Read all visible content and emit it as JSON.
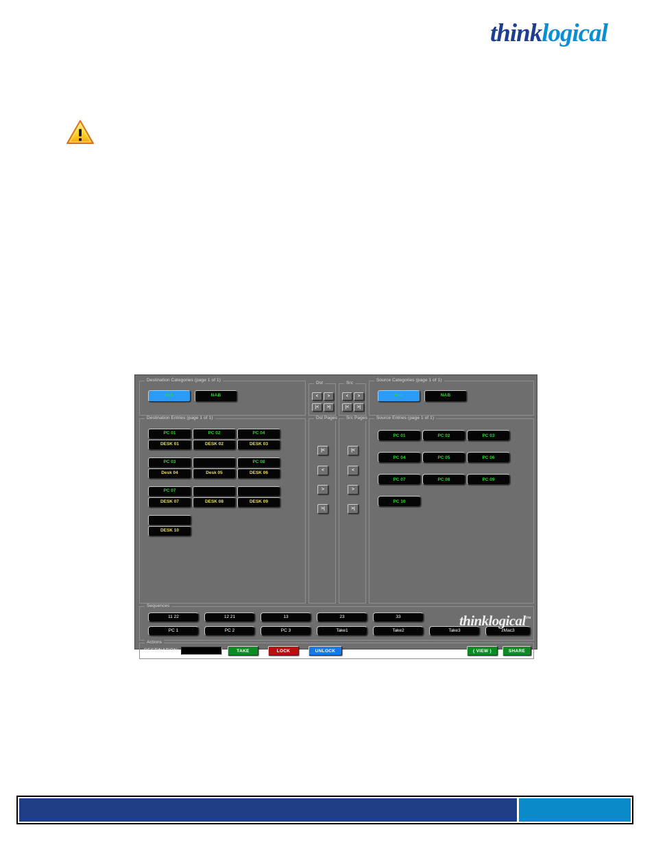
{
  "brand": {
    "part1": "think",
    "part2": "logical"
  },
  "footer": {
    "dark_color": "#1f3d85",
    "light_color": "#0a8ac8"
  },
  "app": {
    "dest_categories": {
      "title": "Destination Categories (page 1 of 1)",
      "buttons": [
        {
          "label": "ALL",
          "selected": true
        },
        {
          "label": "NAB",
          "selected": false
        }
      ]
    },
    "source_categories": {
      "title": "Source Categories (page 1 of 1)",
      "buttons": [
        {
          "label": "ALL",
          "selected": true
        },
        {
          "label": "NAB",
          "selected": false
        }
      ]
    },
    "dest_entries": {
      "title": "Destination Entries (page 1 of 1)",
      "items": [
        {
          "source": "PC 01",
          "dest": "DESK 01"
        },
        {
          "source": "PC 02",
          "dest": "DESK 02"
        },
        {
          "source": "PC 04",
          "dest": "DESK 03"
        },
        {
          "source": "PC 03",
          "dest": "Desk 04"
        },
        {
          "source": "",
          "dest": "Desk 05"
        },
        {
          "source": "PC 08",
          "dest": "DESK 06"
        },
        {
          "source": "PC 07",
          "dest": "DESK 07"
        },
        {
          "source": "",
          "dest": "DESK 08"
        },
        {
          "source": "",
          "dest": "DESK 09"
        },
        {
          "source": "",
          "dest": "DESK 10"
        }
      ]
    },
    "source_entries": {
      "title": "Source Entries (page 1 of 1)",
      "items": [
        "PC 01",
        "PC 02",
        "PC 03",
        "PC 04",
        "PC 05",
        "PC 06",
        "PC 07",
        "PC 08",
        "PC 09",
        "PC 10"
      ]
    },
    "dst_nav": {
      "title": "Dst",
      "buttons": [
        "<",
        ">",
        "|<",
        ">|"
      ]
    },
    "src_nav": {
      "title": "Src",
      "buttons": [
        "<",
        ">",
        "|<",
        ">|"
      ]
    },
    "dst_pages": {
      "title": "Dst Pages",
      "buttons": [
        "|<",
        "<",
        ">",
        ">|"
      ]
    },
    "src_pages": {
      "title": "Src Pages",
      "buttons": [
        "|<",
        "<",
        ">",
        ">|"
      ]
    },
    "sequences": {
      "title": "Sequences",
      "row1": [
        "11 22",
        "12 21",
        "13",
        "23",
        "33"
      ],
      "row2": [
        "PC 1",
        "PC 2",
        "PC 3",
        "Take1",
        "Take2",
        "Take3",
        "zMac3"
      ],
      "logo_think": "think",
      "logo_logical": "logical",
      "logo_tm": "™"
    },
    "actions": {
      "title": "Actions",
      "destination_label": "DESTINATION:",
      "destination_value": "",
      "take": {
        "label": "TAKE",
        "color": "#0d8b22"
      },
      "lock": {
        "label": "LOCK",
        "color": "#b90f12"
      },
      "unlock": {
        "label": "UNLOCK",
        "color": "#1679e8"
      },
      "view": {
        "label": "( VIEW )",
        "color": "#0d8b22"
      },
      "share": {
        "label": "SHARE",
        "color": "#0d8b22"
      }
    }
  }
}
